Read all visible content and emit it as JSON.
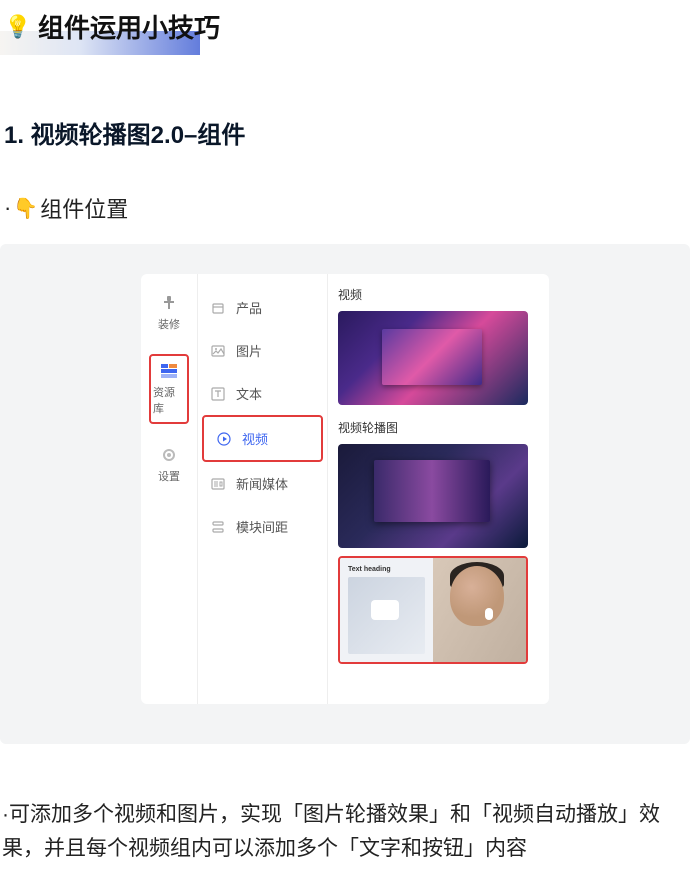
{
  "header": {
    "title": "组件运用小技巧",
    "icon": "lightbulb-icon"
  },
  "section": {
    "heading": "1. 视频轮播图2.0–组件",
    "sub_prefix": "·",
    "point_icon": "👇",
    "sub_label": "组件位置"
  },
  "vnav": [
    {
      "label": "装修",
      "icon": "decorate-icon",
      "active": false
    },
    {
      "label": "资源库",
      "icon": "resource-icon",
      "active": true
    },
    {
      "label": "设置",
      "icon": "gear-icon",
      "active": false
    }
  ],
  "categories": [
    {
      "label": "产品",
      "icon": "package-icon",
      "active": false
    },
    {
      "label": "图片",
      "icon": "image-icon",
      "active": false
    },
    {
      "label": "文本",
      "icon": "text-icon",
      "active": false
    },
    {
      "label": "视频",
      "icon": "play-icon",
      "active": true
    },
    {
      "label": "新闻媒体",
      "icon": "news-icon",
      "active": false
    },
    {
      "label": "模块间距",
      "icon": "spacing-icon",
      "active": false
    }
  ],
  "preview": {
    "group1_label": "视频",
    "group2_label": "视频轮播图",
    "heading_sample": "Text heading"
  },
  "footer": {
    "text": "·可添加多个视频和图片，实现「图片轮播效果」和「视频自动播放」效果，并且每个视频组内可以添加多个「文字和按钮」内容"
  }
}
